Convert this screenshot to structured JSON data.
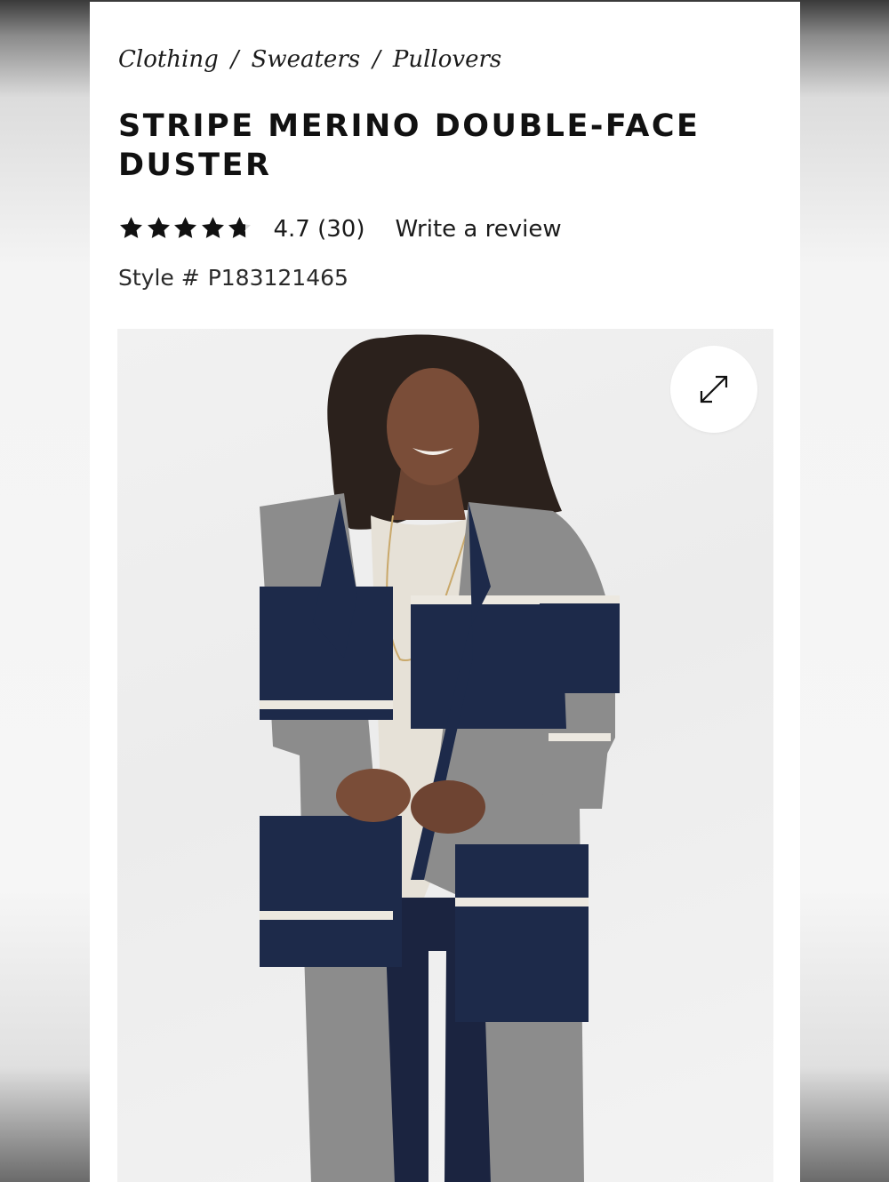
{
  "breadcrumb": {
    "items": [
      "Clothing",
      "Sweaters",
      "Pullovers"
    ],
    "separator": "/"
  },
  "product": {
    "title": "STRIPE MERINO DOUBLE-FACE DUSTER",
    "rating": {
      "value": 4.7,
      "value_text": "4.7",
      "max": 5,
      "count_text": "(30)",
      "write_review_label": "Write a review"
    },
    "style": {
      "label": "Style #",
      "number": "P183121465"
    },
    "image": {
      "expand_icon": "expand-arrows-icon"
    }
  },
  "colors": {
    "navy": "#1d2a4a",
    "heather_gray": "#8c8c8c",
    "ivory": "#ece8e0",
    "text": "#111111"
  }
}
